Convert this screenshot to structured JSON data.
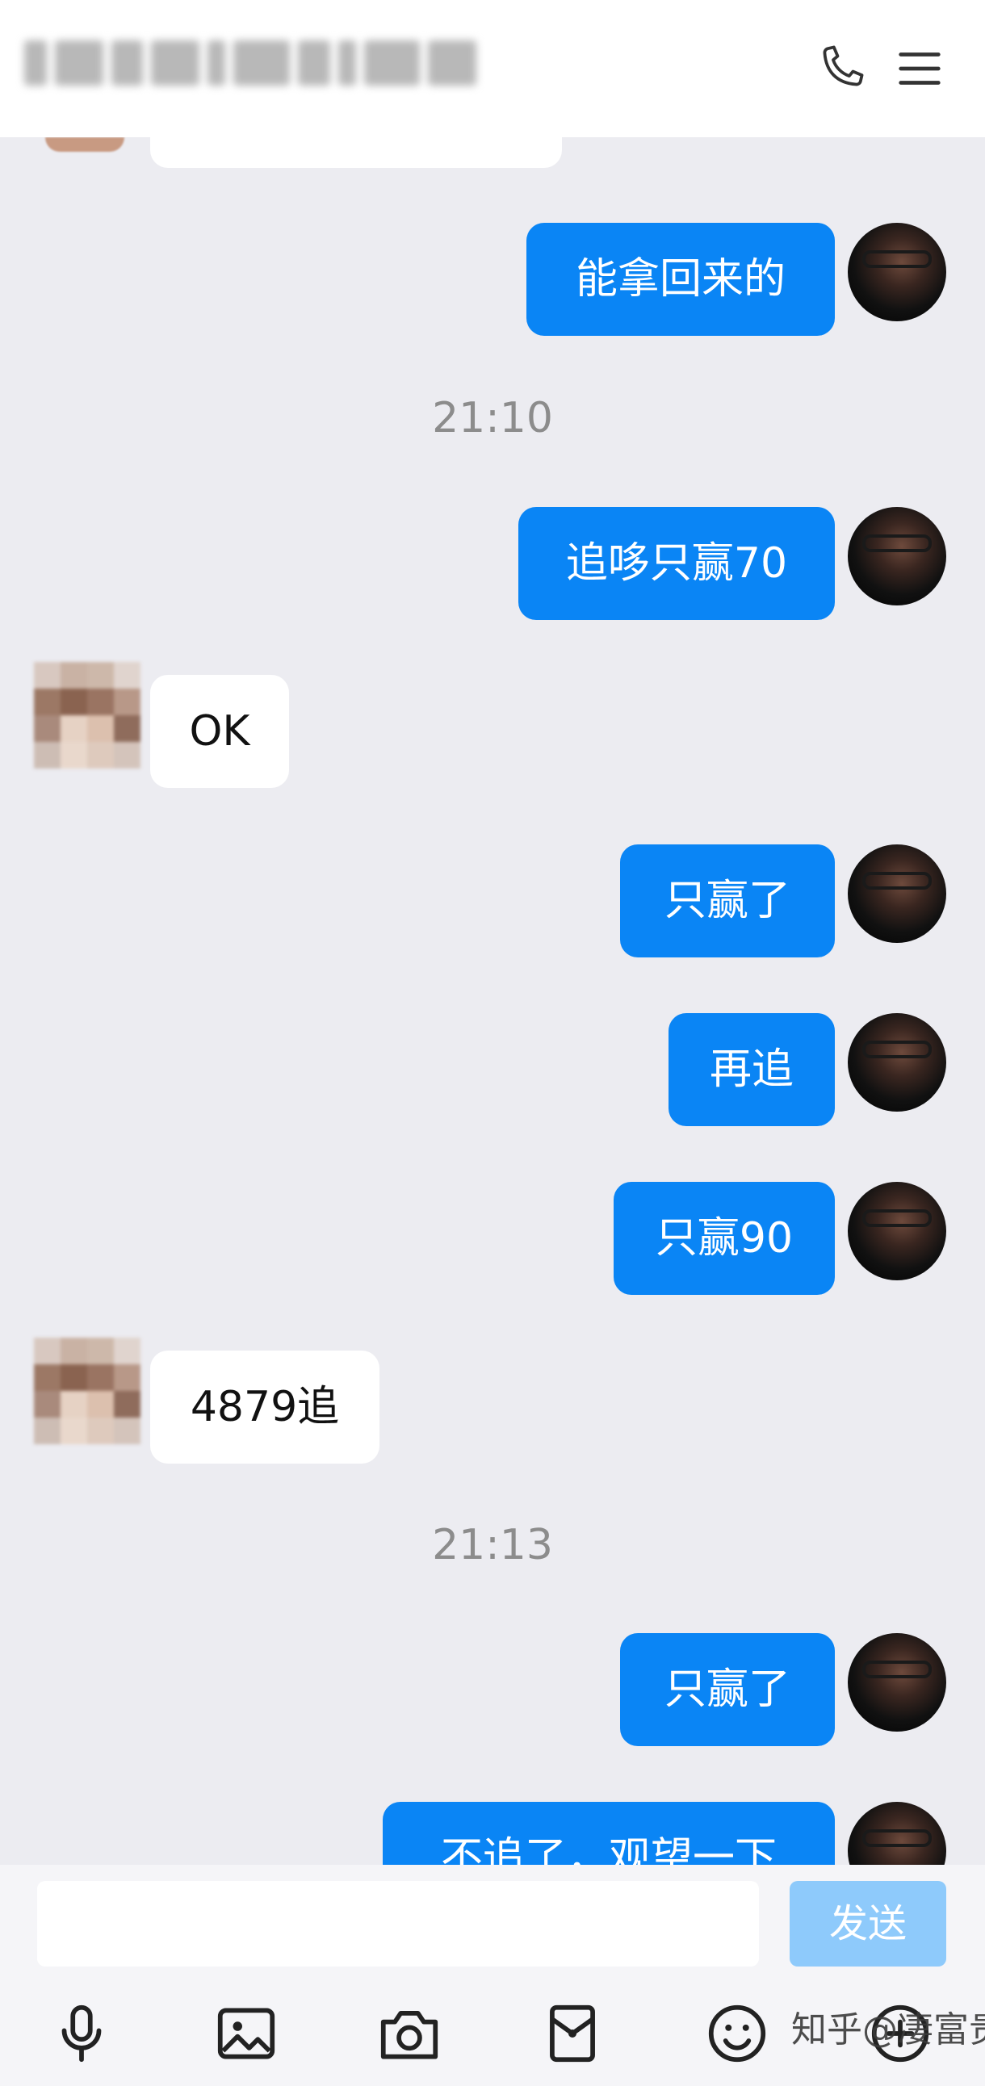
{
  "header": {
    "title_redacted": true,
    "call_icon": "phone-icon",
    "menu_icon": "menu-icon"
  },
  "messages": [
    {
      "type": "out",
      "text": "能拿回来的"
    },
    {
      "type": "time",
      "text": "21:10"
    },
    {
      "type": "out",
      "text": "追哆只赢70"
    },
    {
      "type": "in",
      "text": "OK"
    },
    {
      "type": "out",
      "text": "只赢了"
    },
    {
      "type": "out",
      "text": "再追"
    },
    {
      "type": "out",
      "text": "只赢90"
    },
    {
      "type": "in",
      "text": "4879追"
    },
    {
      "type": "time",
      "text": "21:13"
    },
    {
      "type": "out",
      "text": "只赢了"
    },
    {
      "type": "out",
      "text": "不追了，观望一下"
    }
  ],
  "input": {
    "placeholder": "",
    "send_label": "发送"
  },
  "toolbar": {
    "icons": [
      "microphone-icon",
      "image-icon",
      "camera-icon",
      "red-packet-icon",
      "emoji-icon",
      "plus-icon"
    ]
  },
  "watermark": "知乎@凄富贵",
  "colors": {
    "bubble_out": "#0a85f5",
    "bubble_in": "#ffffff",
    "send_disabled": "#8ecafb",
    "background": "#ececf1"
  }
}
